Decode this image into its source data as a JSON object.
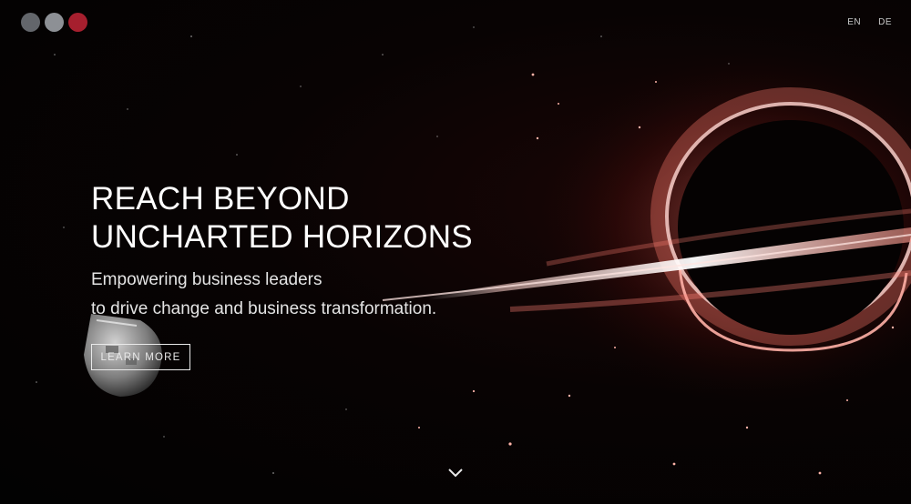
{
  "brand": {
    "logo_colors": [
      "#63666b",
      "#8d9095",
      "#a61f2e"
    ]
  },
  "nav": {
    "languages": [
      {
        "code": "EN"
      },
      {
        "code": "DE"
      }
    ]
  },
  "hero": {
    "headline_lines": [
      "REACH BEYOND",
      "UNCHARTED HORIZONS"
    ],
    "subheadline_lines": [
      "Empowering business leaders",
      "to drive change and business transformation."
    ],
    "cta_label": "LEARN MORE"
  },
  "scroll": {
    "icon": "chevron-down-icon"
  },
  "palette": {
    "background": "#050505",
    "accent_glow": "#ff6b5c",
    "text": "#ffffff"
  }
}
